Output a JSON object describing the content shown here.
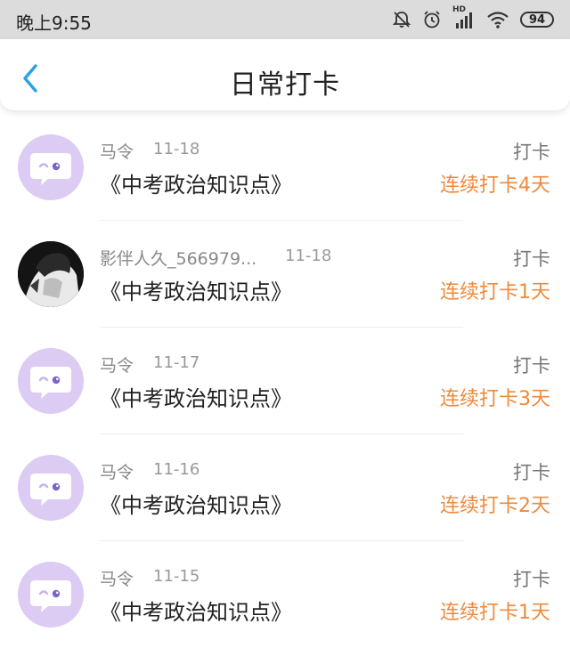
{
  "status_bar": {
    "time": "晚上9:55",
    "battery": "94",
    "network_label": "HD"
  },
  "header": {
    "title": "日常打卡"
  },
  "items": [
    {
      "user": "马令",
      "date": "11-18",
      "book": "《中考政治知识点》",
      "action": "打卡",
      "streak": "连续打卡4天",
      "avatar": "default-purple"
    },
    {
      "user": "影伴人久_566979...",
      "date": "11-18",
      "book": "《中考政治知识点》",
      "action": "打卡",
      "streak": "连续打卡1天",
      "avatar": "photo"
    },
    {
      "user": "马令",
      "date": "11-17",
      "book": "《中考政治知识点》",
      "action": "打卡",
      "streak": "连续打卡3天",
      "avatar": "default-purple"
    },
    {
      "user": "马令",
      "date": "11-16",
      "book": "《中考政治知识点》",
      "action": "打卡",
      "streak": "连续打卡2天",
      "avatar": "default-purple"
    },
    {
      "user": "马令",
      "date": "11-15",
      "book": "《中考政治知识点》",
      "action": "打卡",
      "streak": "连续打卡1天",
      "avatar": "default-purple"
    }
  ],
  "colors": {
    "accent_back": "#2c9fe6",
    "streak": "#ef8a3c",
    "avatar_bg": "#dccbf3",
    "statusbar_bg": "#dcdcdc"
  }
}
